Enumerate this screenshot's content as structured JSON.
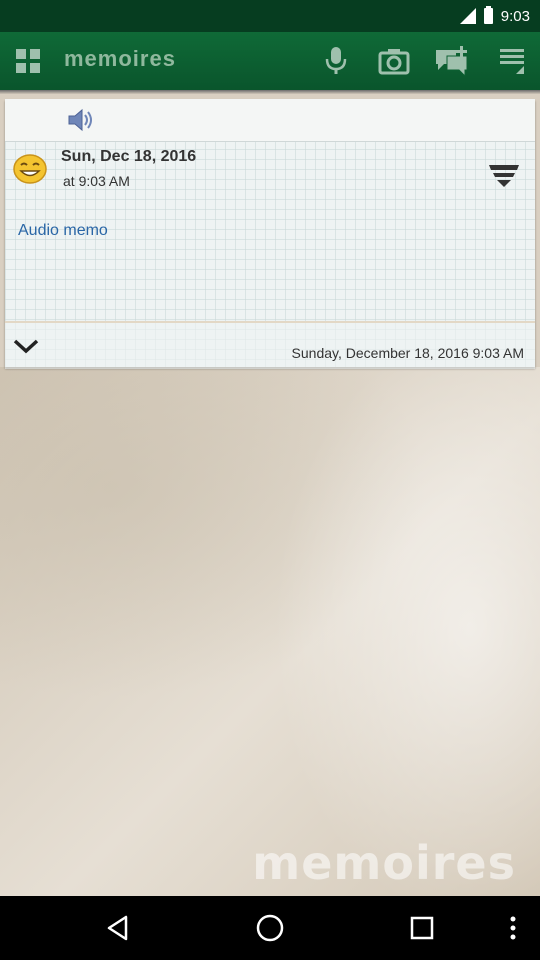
{
  "status_bar": {
    "time": "9:03"
  },
  "app_bar": {
    "title": "memoires",
    "actions": [
      "grid-menu-icon",
      "microphone-icon",
      "camera-icon",
      "add-comment-icon",
      "overflow-menu-icon"
    ]
  },
  "entry": {
    "date": "Sun, Dec 18, 2016",
    "time": "at 9:03 AM",
    "text": "Audio memo",
    "full_date": "Sunday, December 18, 2016 9:03 AM"
  },
  "background": {
    "watermark": "memoires"
  },
  "nav_bar": {
    "buttons": [
      "back-icon",
      "home-icon",
      "recents-icon",
      "more-icon"
    ]
  }
}
